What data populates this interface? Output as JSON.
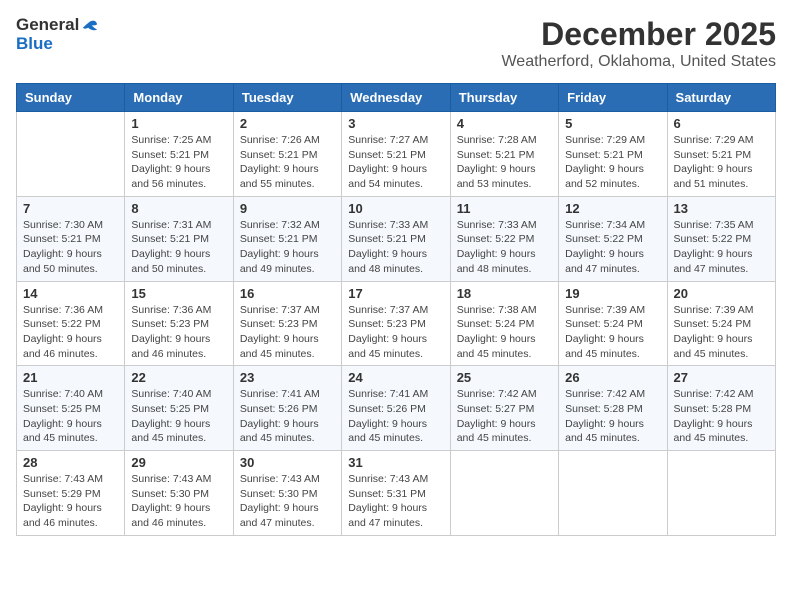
{
  "logo": {
    "general": "General",
    "blue": "Blue"
  },
  "title": "December 2025",
  "location": "Weatherford, Oklahoma, United States",
  "days_of_week": [
    "Sunday",
    "Monday",
    "Tuesday",
    "Wednesday",
    "Thursday",
    "Friday",
    "Saturday"
  ],
  "weeks": [
    [
      {
        "day": "",
        "sunrise": "",
        "sunset": "",
        "daylight": ""
      },
      {
        "day": "1",
        "sunrise": "Sunrise: 7:25 AM",
        "sunset": "Sunset: 5:21 PM",
        "daylight": "Daylight: 9 hours and 56 minutes."
      },
      {
        "day": "2",
        "sunrise": "Sunrise: 7:26 AM",
        "sunset": "Sunset: 5:21 PM",
        "daylight": "Daylight: 9 hours and 55 minutes."
      },
      {
        "day": "3",
        "sunrise": "Sunrise: 7:27 AM",
        "sunset": "Sunset: 5:21 PM",
        "daylight": "Daylight: 9 hours and 54 minutes."
      },
      {
        "day": "4",
        "sunrise": "Sunrise: 7:28 AM",
        "sunset": "Sunset: 5:21 PM",
        "daylight": "Daylight: 9 hours and 53 minutes."
      },
      {
        "day": "5",
        "sunrise": "Sunrise: 7:29 AM",
        "sunset": "Sunset: 5:21 PM",
        "daylight": "Daylight: 9 hours and 52 minutes."
      },
      {
        "day": "6",
        "sunrise": "Sunrise: 7:29 AM",
        "sunset": "Sunset: 5:21 PM",
        "daylight": "Daylight: 9 hours and 51 minutes."
      }
    ],
    [
      {
        "day": "7",
        "sunrise": "Sunrise: 7:30 AM",
        "sunset": "Sunset: 5:21 PM",
        "daylight": "Daylight: 9 hours and 50 minutes."
      },
      {
        "day": "8",
        "sunrise": "Sunrise: 7:31 AM",
        "sunset": "Sunset: 5:21 PM",
        "daylight": "Daylight: 9 hours and 50 minutes."
      },
      {
        "day": "9",
        "sunrise": "Sunrise: 7:32 AM",
        "sunset": "Sunset: 5:21 PM",
        "daylight": "Daylight: 9 hours and 49 minutes."
      },
      {
        "day": "10",
        "sunrise": "Sunrise: 7:33 AM",
        "sunset": "Sunset: 5:21 PM",
        "daylight": "Daylight: 9 hours and 48 minutes."
      },
      {
        "day": "11",
        "sunrise": "Sunrise: 7:33 AM",
        "sunset": "Sunset: 5:22 PM",
        "daylight": "Daylight: 9 hours and 48 minutes."
      },
      {
        "day": "12",
        "sunrise": "Sunrise: 7:34 AM",
        "sunset": "Sunset: 5:22 PM",
        "daylight": "Daylight: 9 hours and 47 minutes."
      },
      {
        "day": "13",
        "sunrise": "Sunrise: 7:35 AM",
        "sunset": "Sunset: 5:22 PM",
        "daylight": "Daylight: 9 hours and 47 minutes."
      }
    ],
    [
      {
        "day": "14",
        "sunrise": "Sunrise: 7:36 AM",
        "sunset": "Sunset: 5:22 PM",
        "daylight": "Daylight: 9 hours and 46 minutes."
      },
      {
        "day": "15",
        "sunrise": "Sunrise: 7:36 AM",
        "sunset": "Sunset: 5:23 PM",
        "daylight": "Daylight: 9 hours and 46 minutes."
      },
      {
        "day": "16",
        "sunrise": "Sunrise: 7:37 AM",
        "sunset": "Sunset: 5:23 PM",
        "daylight": "Daylight: 9 hours and 45 minutes."
      },
      {
        "day": "17",
        "sunrise": "Sunrise: 7:37 AM",
        "sunset": "Sunset: 5:23 PM",
        "daylight": "Daylight: 9 hours and 45 minutes."
      },
      {
        "day": "18",
        "sunrise": "Sunrise: 7:38 AM",
        "sunset": "Sunset: 5:24 PM",
        "daylight": "Daylight: 9 hours and 45 minutes."
      },
      {
        "day": "19",
        "sunrise": "Sunrise: 7:39 AM",
        "sunset": "Sunset: 5:24 PM",
        "daylight": "Daylight: 9 hours and 45 minutes."
      },
      {
        "day": "20",
        "sunrise": "Sunrise: 7:39 AM",
        "sunset": "Sunset: 5:24 PM",
        "daylight": "Daylight: 9 hours and 45 minutes."
      }
    ],
    [
      {
        "day": "21",
        "sunrise": "Sunrise: 7:40 AM",
        "sunset": "Sunset: 5:25 PM",
        "daylight": "Daylight: 9 hours and 45 minutes."
      },
      {
        "day": "22",
        "sunrise": "Sunrise: 7:40 AM",
        "sunset": "Sunset: 5:25 PM",
        "daylight": "Daylight: 9 hours and 45 minutes."
      },
      {
        "day": "23",
        "sunrise": "Sunrise: 7:41 AM",
        "sunset": "Sunset: 5:26 PM",
        "daylight": "Daylight: 9 hours and 45 minutes."
      },
      {
        "day": "24",
        "sunrise": "Sunrise: 7:41 AM",
        "sunset": "Sunset: 5:26 PM",
        "daylight": "Daylight: 9 hours and 45 minutes."
      },
      {
        "day": "25",
        "sunrise": "Sunrise: 7:42 AM",
        "sunset": "Sunset: 5:27 PM",
        "daylight": "Daylight: 9 hours and 45 minutes."
      },
      {
        "day": "26",
        "sunrise": "Sunrise: 7:42 AM",
        "sunset": "Sunset: 5:28 PM",
        "daylight": "Daylight: 9 hours and 45 minutes."
      },
      {
        "day": "27",
        "sunrise": "Sunrise: 7:42 AM",
        "sunset": "Sunset: 5:28 PM",
        "daylight": "Daylight: 9 hours and 45 minutes."
      }
    ],
    [
      {
        "day": "28",
        "sunrise": "Sunrise: 7:43 AM",
        "sunset": "Sunset: 5:29 PM",
        "daylight": "Daylight: 9 hours and 46 minutes."
      },
      {
        "day": "29",
        "sunrise": "Sunrise: 7:43 AM",
        "sunset": "Sunset: 5:30 PM",
        "daylight": "Daylight: 9 hours and 46 minutes."
      },
      {
        "day": "30",
        "sunrise": "Sunrise: 7:43 AM",
        "sunset": "Sunset: 5:30 PM",
        "daylight": "Daylight: 9 hours and 47 minutes."
      },
      {
        "day": "31",
        "sunrise": "Sunrise: 7:43 AM",
        "sunset": "Sunset: 5:31 PM",
        "daylight": "Daylight: 9 hours and 47 minutes."
      },
      {
        "day": "",
        "sunrise": "",
        "sunset": "",
        "daylight": ""
      },
      {
        "day": "",
        "sunrise": "",
        "sunset": "",
        "daylight": ""
      },
      {
        "day": "",
        "sunrise": "",
        "sunset": "",
        "daylight": ""
      }
    ]
  ]
}
